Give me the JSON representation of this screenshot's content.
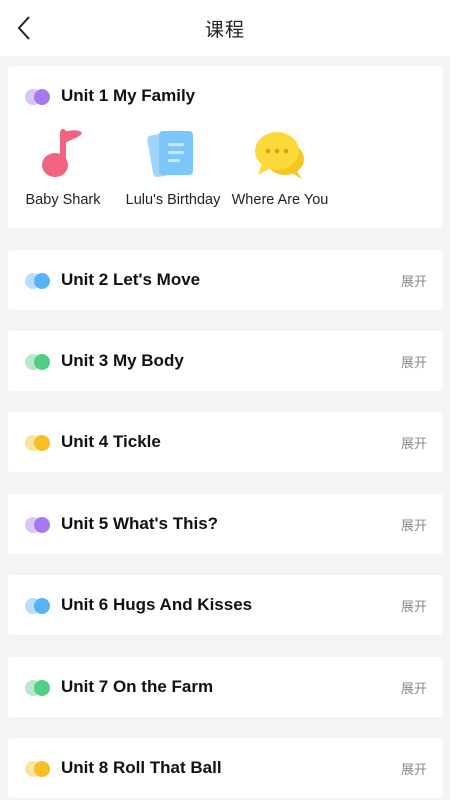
{
  "header": {
    "title": "课程"
  },
  "colors": {
    "purple": {
      "light": "#d9c5f7",
      "dark": "#a978ee"
    },
    "blue": {
      "light": "#b9ddfa",
      "dark": "#56b3f5"
    },
    "green": {
      "light": "#b7e8cb",
      "dark": "#4fcf84"
    },
    "yellow": {
      "light": "#fbe3a2",
      "dark": "#f7bf23"
    }
  },
  "units": [
    {
      "title": "Unit 1 My Family",
      "color": "purple",
      "expanded": true,
      "lessons": [
        {
          "label": "Baby Shark",
          "icon": "music-note-icon"
        },
        {
          "label": "Lulu's Birthday",
          "icon": "document-icon"
        },
        {
          "label": "Where Are You",
          "icon": "chat-bubble-icon"
        }
      ]
    },
    {
      "title": "Unit 2 Let's Move",
      "color": "blue",
      "expand_label": "展开"
    },
    {
      "title": "Unit 3 My Body",
      "color": "green",
      "expand_label": "展开"
    },
    {
      "title": "Unit 4 Tickle",
      "color": "yellow",
      "expand_label": "展开"
    },
    {
      "title": "Unit 5 What's This?",
      "color": "purple",
      "expand_label": "展开"
    },
    {
      "title": "Unit 6 Hugs And Kisses",
      "color": "blue",
      "expand_label": "展开"
    },
    {
      "title": "Unit 7 On the Farm",
      "color": "green",
      "expand_label": "展开"
    },
    {
      "title": "Unit 8 Roll That Ball",
      "color": "yellow",
      "expand_label": "展开"
    }
  ]
}
